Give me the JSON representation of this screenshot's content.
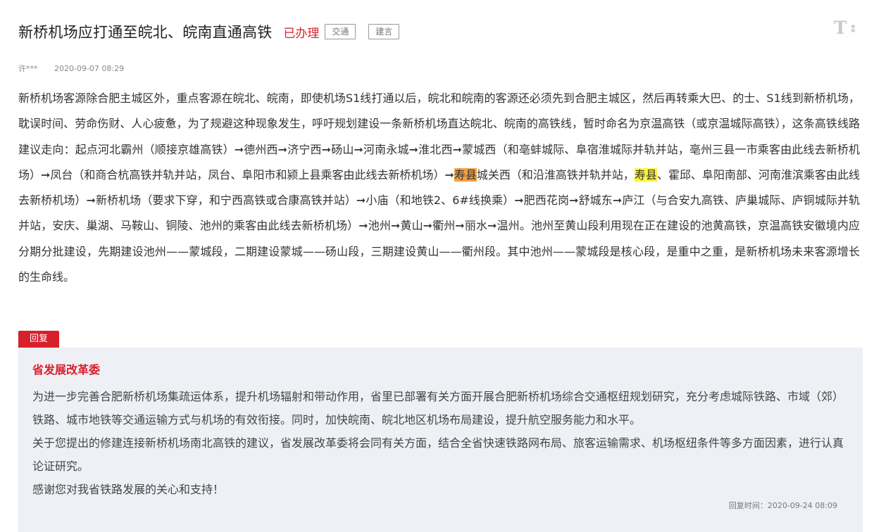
{
  "header": {
    "title": "新桥机场应打通至皖北、皖南直通高铁",
    "status": "已办理",
    "tags": [
      "交通",
      "建言"
    ],
    "font_toggle": "T"
  },
  "meta": {
    "author": "许***",
    "date": "2020-09-07 08:29"
  },
  "content": {
    "p1": "新桥机场客源除合肥主城区外，重点客源在皖北、皖南，即使机场S1线打通以后，皖北和皖南的客源还必须先到合肥主城区，然后再转乘大巴、的士、S1线到新桥机场，耽误时间、劳命伤财、人心疲惫，为了规避这种现象发生，呼吁规划建设一条新桥机场直达皖北、皖南的高铁线，暂时命名为京温高铁（或京温城际高铁），这条高铁线路建议走向：起点河北霸州（顺接京雄高铁）➞德州西➞济宁西➞砀山➞河南永城➞淮北西➞蒙城西（和亳蚌城际、阜宿淮城际并轨并站，亳州三县一市乘客由此线去新桥机场）➞凤台（和商合杭高铁并轨并站，凤台、阜阳市和颍上县乘客由此线去新桥机场）➞",
    "hl1": "寿县",
    "p2": "城关西（和沿淮高铁并轨并站，",
    "hl2": "寿县",
    "p3": "、霍邱、阜阳南部、河南淮滨乘客由此线去新桥机场）➞新桥机场（要求下穿，和宁西高铁或合康高铁并站）➞小庙（和地铁2、6#线换乘）➞肥西花岗➞舒城东➞庐江（与合安九高铁、庐巢城际、庐铜城际并轨并站，安庆、巢湖、马鞍山、铜陵、池州的乘客由此线去新桥机场）➞池州➞黄山➞衢州➞丽水➞温州。池州至黄山段利用现在正在建设的池黄高铁，京温高铁安徽境内应分期分批建设，先期建设池州——蒙城段，二期建设蒙城——砀山段，三期建设黄山——衢州段。其中池州——蒙城段是核心段，是重中之重，是新桥机场未来客源增长的生命线。"
  },
  "reply": {
    "badge": "回复",
    "org": "省发展改革委",
    "paragraphs": [
      "为进一步完善合肥新桥机场集疏运体系，提升机场辐射和带动作用，省里已部署有关方面开展合肥新桥机场综合交通枢纽规划研究，充分考虑城际铁路、市域（郊）铁路、城市地铁等交通运输方式与机场的有效衔接。同时，加快皖南、皖北地区机场布局建设，提升航空服务能力和水平。",
      "关于您提出的修建连接新桥机场南北高铁的建议，省发展改革委将会同有关方面，结合全省快速铁路网布局、旅客运输需求、机场枢纽条件等多方面因素，进行认真论证研究。",
      "感谢您对我省铁路发展的关心和支持！"
    ],
    "time": "回复时间：2020-09-24 08:09"
  },
  "colors": {
    "accent": "#d8202b",
    "highlight_orange": "#f3a042",
    "highlight_yellow": "#fff33b",
    "reply_bg": "#eef0f5"
  },
  "icons": {
    "font_toggle": "font-size-toggle-icon"
  }
}
